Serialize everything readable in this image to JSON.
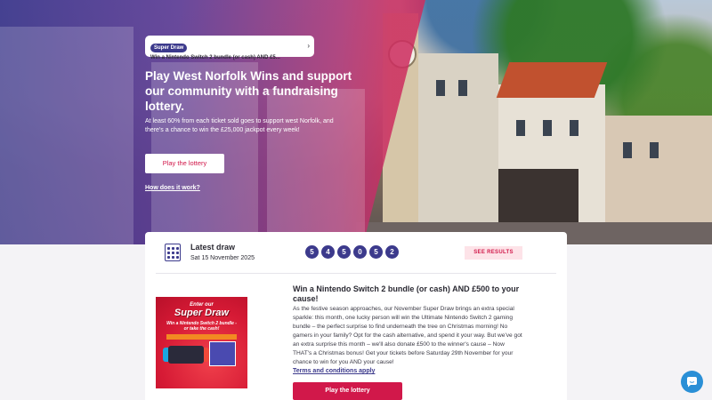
{
  "hero": {
    "badge": "Super Draw",
    "badge_text": "Win a Nintendo Switch 2 bundle (or cash) AND £5...",
    "title": "Play West Norfolk Wins and support our community with a fundraising lottery.",
    "description": "At least 60% from each ticket sold goes to support west Norfolk, and there's a chance to win the £25,000 jackpot every week!",
    "cta": "Play the lottery",
    "link": "How does it work?"
  },
  "latest_draw": {
    "label": "Latest draw",
    "date": "Sat 15 November 2025",
    "numbers": [
      "5",
      "4",
      "5",
      "0",
      "5",
      "2"
    ],
    "results_button": "SEE RESULTS"
  },
  "promo": {
    "image_enter": "Enter our",
    "image_title": "Super Draw",
    "image_sub": "Win a Nintendo Switch 2 bundle - or take the cash!",
    "title": "Win a Nintendo Switch 2 bundle (or cash) AND £500 to your cause!",
    "body": "As the festive season approaches, our November Super Draw brings an extra special sparkle: this month, one lucky person will win the Ultimate Nintendo Switch 2 gaming bundle – the perfect surprise to find underneath the tree on Christmas morning! No gamers in your family? Opt for the cash alternative, and spend it your way. But we've got an extra surprise this month – we'll also donate £500 to the winner's cause – Now THAT's a Christmas bonus! Get your tickets before Saturday 29th November for your chance to win for you AND your cause!",
    "terms": "Terms and conditions apply",
    "cta": "Play the lottery"
  },
  "colors": {
    "brand_purple": "#3c3a8c",
    "brand_pink": "#d1184a",
    "chat_blue": "#2a8fd6"
  },
  "icons": {
    "calendar": "calendar-grid-icon",
    "chevron": "chevron-right-icon",
    "chat": "chat-bubble-icon"
  }
}
